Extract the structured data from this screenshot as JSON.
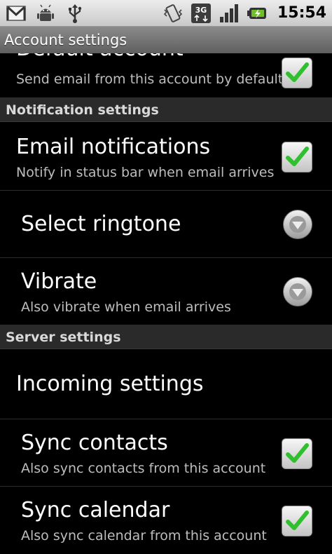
{
  "status_bar": {
    "icons_left": [
      "gmail-icon",
      "android-debug-icon",
      "usb-icon"
    ],
    "icons_right": [
      "vibrate-icon",
      "3g-data-icon",
      "signal-icon",
      "battery-charging-icon"
    ],
    "network_label": "3G",
    "time": "15:54"
  },
  "title_bar": {
    "title": "Account settings"
  },
  "rows": {
    "default_account": {
      "title": "Default account",
      "summary": "Send email from this account by default",
      "checked": true
    },
    "email_notifications": {
      "title": "Email notifications",
      "summary": "Notify in status bar when email arrives",
      "checked": true
    },
    "select_ringtone": {
      "title": "Select ringtone"
    },
    "vibrate": {
      "title": "Vibrate",
      "summary": "Also vibrate when email arrives"
    },
    "incoming_settings": {
      "title": "Incoming settings"
    },
    "sync_contacts": {
      "title": "Sync contacts",
      "summary": "Also sync contacts from this account",
      "checked": true
    },
    "sync_calendar": {
      "title": "Sync calendar",
      "summary": "Also sync calendar from this account",
      "checked": true
    }
  },
  "sections": {
    "notification": "Notification settings",
    "server": "Server settings"
  },
  "colors": {
    "check": "#2fbf2f",
    "background": "#000000",
    "section_bg": "#2a2a2a",
    "summary_text": "#bdbdbd"
  }
}
